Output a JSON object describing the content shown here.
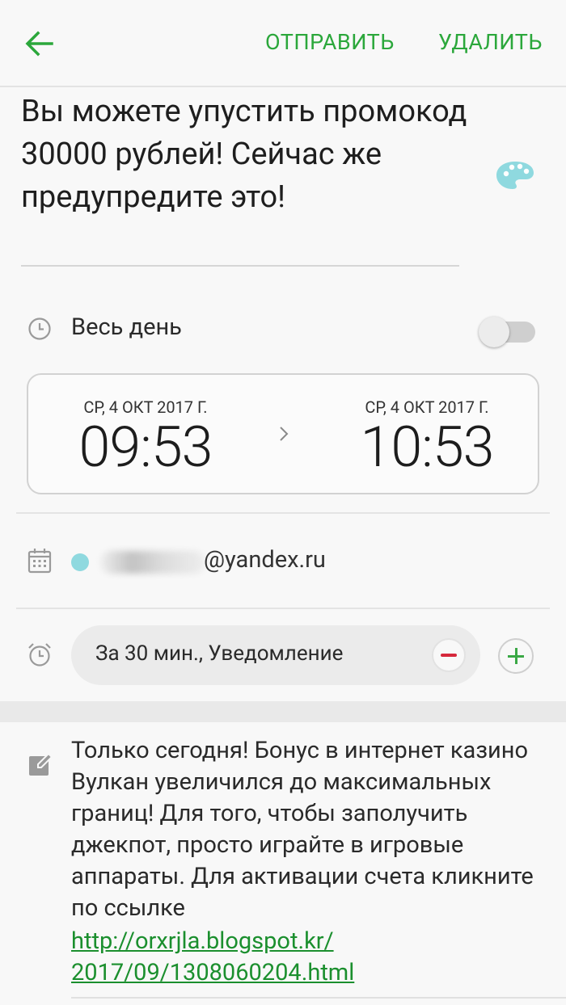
{
  "toolbar": {
    "send_label": "ОТПРАВИТЬ",
    "delete_label": "УДАЛИТЬ",
    "accent_color": "#2ba73b"
  },
  "event": {
    "title": "Вы можете упустить промокод 30000 рублей! Сейчас же предупредите это!",
    "all_day_label": "Весь день",
    "all_day_enabled": false,
    "start": {
      "date": "СР, 4 ОКТ 2017 Г.",
      "time": "09:53"
    },
    "end": {
      "date": "СР, 4 ОКТ 2017 Г.",
      "time": "10:53"
    },
    "calendar": {
      "account_visible": "@yandex.ru",
      "dot_color": "#8fd9df"
    },
    "reminder": {
      "label": "За 30 мин., Уведомление"
    },
    "notes": {
      "text": "Только сегодня! Бонус в интернет казино Вулкан увеличился до максимальных границ! Для того, чтобы заполучить джекпот, просто играйте в игровые аппараты. Для активации счета кликните по ссылке",
      "link": "http://orxrjla.blogspot.kr/ 2017/09/1308060204.html"
    }
  }
}
